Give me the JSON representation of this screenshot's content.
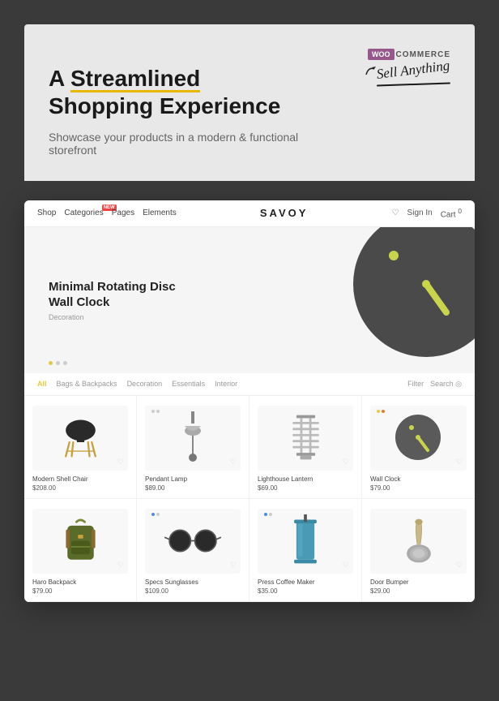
{
  "background_color": "#3a3a3a",
  "woo": {
    "logo_label": "WOO",
    "commerce_label": "COMMERCE",
    "sell_anything": "Sell Anything"
  },
  "headline": {
    "line1_prefix": "A ",
    "line1_underlined": "Streamlined",
    "line2": "Shopping Experience"
  },
  "subtitle": "Showcase your products in a modern & functional storefront",
  "store": {
    "name": "SAVOY",
    "nav_items": [
      "Shop",
      "Categories",
      "Pages",
      "Elements"
    ],
    "nav_right": [
      "Sign In",
      "Cart"
    ]
  },
  "hero": {
    "title": "Minimal Rotating Disc\nWall Clock",
    "subtitle": "Decoration",
    "dots": [
      true,
      false,
      false
    ]
  },
  "filters": {
    "tags": [
      "All",
      "Bags & Backpacks",
      "Decoration",
      "Essentials",
      "Interior"
    ],
    "active": "All",
    "right": [
      "Filter",
      "Search"
    ]
  },
  "products": [
    {
      "name": "Modern Shell Chair",
      "price": "$208.00",
      "type": "chair",
      "dots": []
    },
    {
      "name": "Pendant Lamp",
      "price": "$89.00",
      "type": "lamp",
      "dots": [
        "gray",
        "gray"
      ]
    },
    {
      "name": "Lighthouse Lantern",
      "price": "$69.00",
      "type": "lantern",
      "dots": []
    },
    {
      "name": "Wall Clock",
      "price": "$79.00",
      "type": "clock",
      "dots": [
        "yellow",
        "orange"
      ]
    },
    {
      "name": "Haro Backpack",
      "price": "$79.00",
      "type": "backpack",
      "dots": []
    },
    {
      "name": "Specs Sunglasses",
      "price": "$109.00",
      "type": "glasses",
      "dots": [
        "blue",
        "gray"
      ]
    },
    {
      "name": "Press Coffee Maker",
      "price": "$35.00",
      "type": "coffee",
      "dots": [
        "blue",
        "gray"
      ]
    },
    {
      "name": "Door Bumper",
      "price": "$29.00",
      "type": "bumper",
      "dots": []
    }
  ]
}
